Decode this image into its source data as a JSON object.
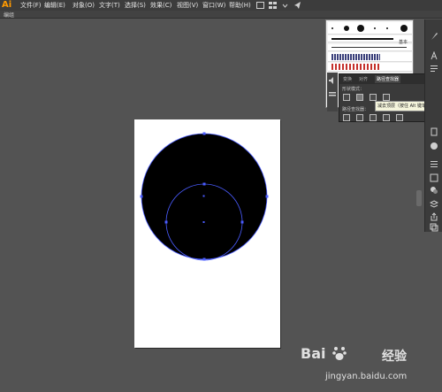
{
  "app": {
    "logo": "Ai"
  },
  "menubar": {
    "items": [
      {
        "label": "文件(F)",
        "name": "menu-file"
      },
      {
        "label": "编辑(E)",
        "name": "menu-edit"
      },
      {
        "label": "对象(O)",
        "name": "menu-object"
      },
      {
        "label": "文字(T)",
        "name": "menu-type"
      },
      {
        "label": "选择(S)",
        "name": "menu-select"
      },
      {
        "label": "效果(C)",
        "name": "menu-effect"
      },
      {
        "label": "视图(V)",
        "name": "menu-view"
      },
      {
        "label": "窗口(W)",
        "name": "menu-window"
      },
      {
        "label": "帮助(H)",
        "name": "menu-help"
      }
    ]
  },
  "controlbar": {
    "selection_label": "编组"
  },
  "brushes": {
    "basic_label": "基本"
  },
  "pathfinder": {
    "tabs": [
      "变换",
      "对齐",
      "路径查找器"
    ],
    "active_tab": "路径查找器",
    "shape_modes_label": "形状模式：",
    "pathfinders_label": "路径查找器：",
    "expand_label": "扩展"
  },
  "tooltip": {
    "text": "减去顶层（按住 Alt 键单击，以创建复合形状）"
  },
  "watermark": {
    "logo": "Bai",
    "logo_du": "经验",
    "url": "jingyan.baidu.com"
  },
  "colors": {
    "menubar_bg": "#3c3c3c",
    "canvas_bg": "#535353",
    "artboard_bg": "#ffffff",
    "shape_fill": "#000000",
    "path_stroke": "#4a5cff",
    "logo": "#ff9a00"
  },
  "icons": [
    "brush-icon",
    "type-icon",
    "paragraph-icon",
    "layers-icon",
    "link-icon",
    "swatches-icon",
    "symbols-icon",
    "graphic-styles-icon",
    "export-icon",
    "artboards-icon"
  ]
}
